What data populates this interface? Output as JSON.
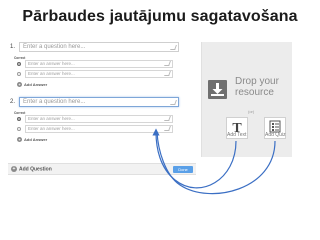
{
  "title": "Pārbaudes jautājumu sagatavošana",
  "questions": [
    {
      "number": "1.",
      "placeholder": "Enter a question here...",
      "correct_label": "Correct",
      "answers": [
        "Enter an answer here...",
        "Enter an answer here..."
      ],
      "add_answer": "Add Answer"
    },
    {
      "number": "2.",
      "placeholder": "Enter a question here...",
      "correct_label": "Correct",
      "answers": [
        "Enter an answer here...",
        "Enter an answer here..."
      ],
      "add_answer": "Add Answer"
    }
  ],
  "footer": {
    "add_question": "Add Question",
    "done": "Done"
  },
  "resource_panel": {
    "drop_line1": "Drop your",
    "drop_line2": "resource",
    "or": "(or)",
    "add_text": "Add Text",
    "add_quiz": "Add Quiz"
  },
  "colors": {
    "arrow": "#3b6fc4",
    "done_button": "#5aa0e8"
  }
}
